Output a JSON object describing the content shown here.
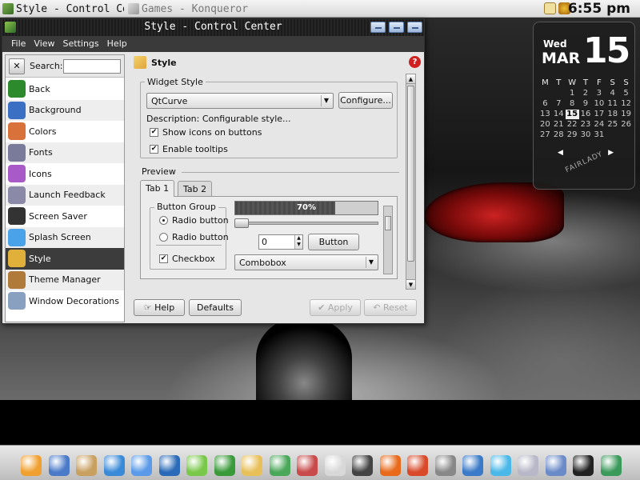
{
  "taskbar": {
    "tasks": [
      {
        "label": "Style - Control Cente",
        "active": true
      },
      {
        "label": "Games - Konqueror",
        "active": false
      }
    ],
    "clock": "6:55 pm"
  },
  "window": {
    "title": "Style - Control Center",
    "menu": [
      "File",
      "View",
      "Settings",
      "Help"
    ]
  },
  "sidebar": {
    "search_label": "Search:",
    "search_value": "",
    "items": [
      {
        "label": "Back",
        "icon": "back-arrow-icon",
        "color": "#2c8a2c"
      },
      {
        "label": "Background",
        "icon": "background-icon",
        "color": "#3a6fc4"
      },
      {
        "label": "Colors",
        "icon": "colors-icon",
        "color": "#d9713a"
      },
      {
        "label": "Fonts",
        "icon": "fonts-icon",
        "color": "#7a7a9a"
      },
      {
        "label": "Icons",
        "icon": "icons-icon",
        "color": "#a85ac8"
      },
      {
        "label": "Launch Feedback",
        "icon": "launch-feedback-icon",
        "color": "#8a8aa8"
      },
      {
        "label": "Screen Saver",
        "icon": "screen-saver-icon",
        "color": "#333333"
      },
      {
        "label": "Splash Screen",
        "icon": "splash-screen-icon",
        "color": "#4aa3e8"
      },
      {
        "label": "Style",
        "icon": "style-icon",
        "color": "#e0b03a"
      },
      {
        "label": "Theme Manager",
        "icon": "theme-manager-icon",
        "color": "#b07a3a"
      },
      {
        "label": "Window Decorations",
        "icon": "window-decorations-icon",
        "color": "#8aa0c0"
      }
    ],
    "selected_index": 8
  },
  "content": {
    "header": "Style",
    "widget_style": {
      "group_title": "Widget Style",
      "combo_value": "QtCurve",
      "configure_label": "Configure...",
      "description": "Description: Configurable style...",
      "show_icons_label": "Show icons on buttons",
      "show_icons_checked": true,
      "tooltips_label": "Enable tooltips",
      "tooltips_checked": true
    },
    "preview": {
      "title": "Preview",
      "tabs": [
        "Tab 1",
        "Tab 2"
      ],
      "button_group_title": "Button Group",
      "radio1": "Radio button",
      "radio2": "Radio button",
      "checkbox": "Checkbox",
      "checkbox_checked": true,
      "progress_text": "70%",
      "progress_value": 0.7,
      "slider_value": 0,
      "spin_value": "0",
      "button_label": "Button",
      "combobox_value": "Combobox"
    }
  },
  "buttons": {
    "help": "Help",
    "defaults": "Defaults",
    "apply": "Apply",
    "reset": "Reset"
  },
  "calendar": {
    "weekday": "Wed",
    "month": "MAR",
    "day": "15",
    "headers": [
      "M",
      "T",
      "W",
      "T",
      "F",
      "S",
      "S"
    ],
    "days": [
      "",
      "",
      "1",
      "2",
      "3",
      "4",
      "5",
      "6",
      "7",
      "8",
      "9",
      "10",
      "11",
      "12",
      "13",
      "14",
      "15",
      "16",
      "17",
      "18",
      "19",
      "20",
      "21",
      "22",
      "23",
      "24",
      "25",
      "26",
      "27",
      "28",
      "29",
      "30",
      "31",
      "",
      ""
    ],
    "today": "15",
    "brand": "FAIRLADY"
  },
  "dock": {
    "icons": [
      "system-icon",
      "monitor-icon",
      "home-icon",
      "network-icon",
      "browser-icon",
      "internet-icon",
      "settings-icon",
      "media-icon",
      "mail-icon",
      "calc-icon",
      "toolbox-icon",
      "cd-icon",
      "headset-icon",
      "firefox-icon",
      "chart-icon",
      "gimp-icon",
      "photo-icon",
      "blocks-icon",
      "printer-icon",
      "network-config-icon",
      "terminal-icon",
      "stats-icon"
    ]
  }
}
